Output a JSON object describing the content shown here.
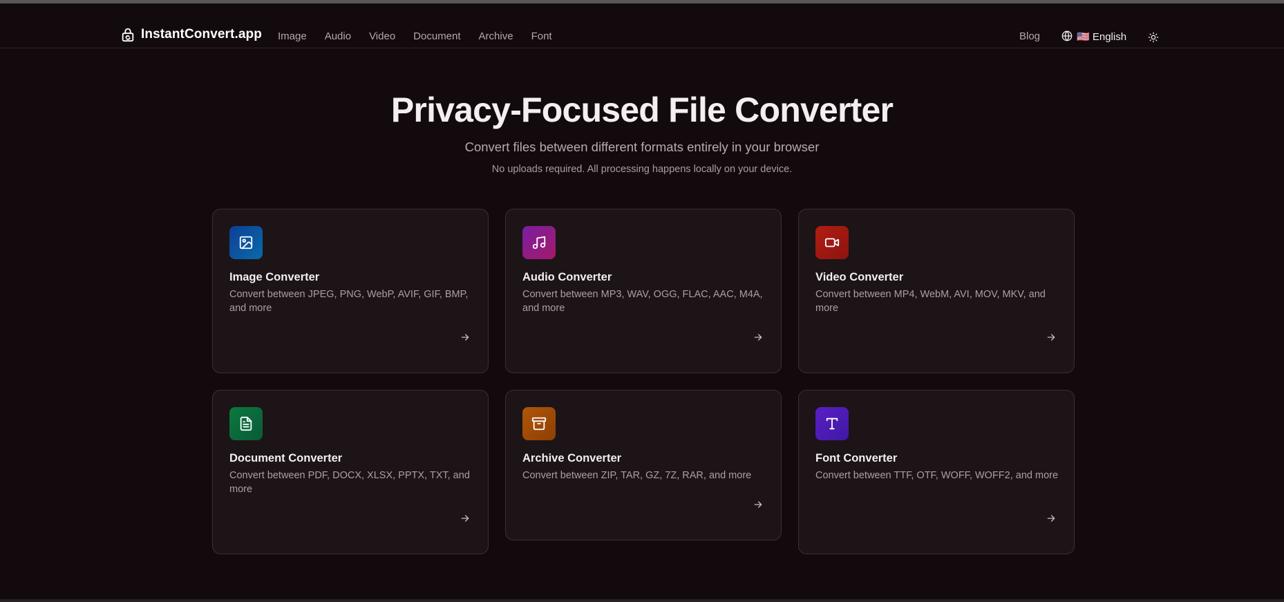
{
  "header": {
    "brand": "InstantConvert.app",
    "nav": [
      "Image",
      "Audio",
      "Video",
      "Document",
      "Archive",
      "Font"
    ],
    "blog": "Blog",
    "language": "🇺🇸 English"
  },
  "hero": {
    "title": "Privacy-Focused File Converter",
    "subtitle": "Convert files between different formats entirely in your browser",
    "note": "No uploads required. All processing happens locally on your device."
  },
  "cards": [
    {
      "title": "Image Converter",
      "desc": "Convert between JPEG, PNG, WebP, AVIF, GIF, BMP, and more",
      "icon": "image-icon",
      "color": "#0b4a9e"
    },
    {
      "title": "Audio Converter",
      "desc": "Convert between MP3, WAV, OGG, FLAC, AAC, M4A, and more",
      "icon": "music-icon",
      "color": "#8a1d8c"
    },
    {
      "title": "Video Converter",
      "desc": "Convert between MP4, WebM, AVI, MOV, MKV, and more",
      "icon": "video-camera-icon",
      "color": "#a51a13"
    },
    {
      "title": "Document Converter",
      "desc": "Convert between PDF, DOCX, XLSX, PPTX, TXT, and more",
      "icon": "document-icon",
      "color": "#0c6a3a"
    },
    {
      "title": "Archive Converter",
      "desc": "Convert between ZIP, TAR, GZ, 7Z, RAR, and more",
      "icon": "archive-box-icon",
      "color": "#a14a06"
    },
    {
      "title": "Font Converter",
      "desc": "Convert between TTF, OTF, WOFF, WOFF2, and more",
      "icon": "font-type-icon",
      "color": "#4c1cb4"
    }
  ]
}
